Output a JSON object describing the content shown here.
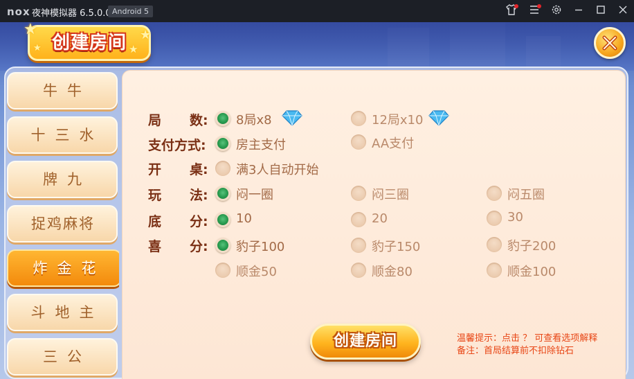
{
  "titlebar": {
    "logo": "nox",
    "app_title": "夜神模拟器 6.5.0.0",
    "android_badge": "Android 5",
    "icons": [
      "shirt-icon",
      "menu-icon",
      "settings-icon",
      "minimize-icon",
      "maximize-icon",
      "close-icon"
    ]
  },
  "game": {
    "title": "创建房间",
    "tabs": [
      {
        "label": "牛牛",
        "active": false
      },
      {
        "label": "十三水",
        "active": false
      },
      {
        "label": "牌九",
        "active": false
      },
      {
        "label": "捉鸡麻将",
        "active": false
      },
      {
        "label": "炸金花",
        "active": true
      },
      {
        "label": "斗地主",
        "active": false
      },
      {
        "label": "三公",
        "active": false
      }
    ],
    "rows": [
      {
        "label": "局数:",
        "options": [
          {
            "text": "8局x8",
            "selected": true,
            "gem": true
          },
          {
            "text": "12局x10",
            "selected": false,
            "gem": true
          }
        ]
      },
      {
        "label": "支付方式:",
        "options": [
          {
            "text": "房主支付",
            "selected": true
          },
          {
            "text": "AA支付",
            "selected": false
          }
        ]
      },
      {
        "label": "开桌:",
        "options": [
          {
            "text": "满3人自动开始",
            "selected": false
          }
        ]
      },
      {
        "label": "玩法:",
        "options": [
          {
            "text": "闷一圈",
            "selected": true
          },
          {
            "text": "闷三圈",
            "selected": false
          },
          {
            "text": "闷五圈",
            "selected": false
          }
        ]
      },
      {
        "label": "底分:",
        "options": [
          {
            "text": "10",
            "selected": true
          },
          {
            "text": "20",
            "selected": false
          },
          {
            "text": "30",
            "selected": false
          }
        ]
      },
      {
        "label": "喜分:",
        "options": [
          {
            "text": "豹子100",
            "selected": true
          },
          {
            "text": "豹子150",
            "selected": false
          },
          {
            "text": "豹子200",
            "selected": false
          }
        ]
      },
      {
        "label": "",
        "options": [
          {
            "text": "顺金50",
            "selected": false
          },
          {
            "text": "顺金80",
            "selected": false
          },
          {
            "text": "顺金100",
            "selected": false
          }
        ]
      }
    ],
    "create_button": "创建房间",
    "hint_line1": "温馨提示：点击 ？ 可查看选项解释",
    "hint_line2": "备注：首局结算前不扣除钻石"
  },
  "colors": {
    "accent_orange": "#f38a0c",
    "label_brown": "#7a2f14",
    "radio_green": "#279a4e",
    "hint_red": "#e84615"
  }
}
